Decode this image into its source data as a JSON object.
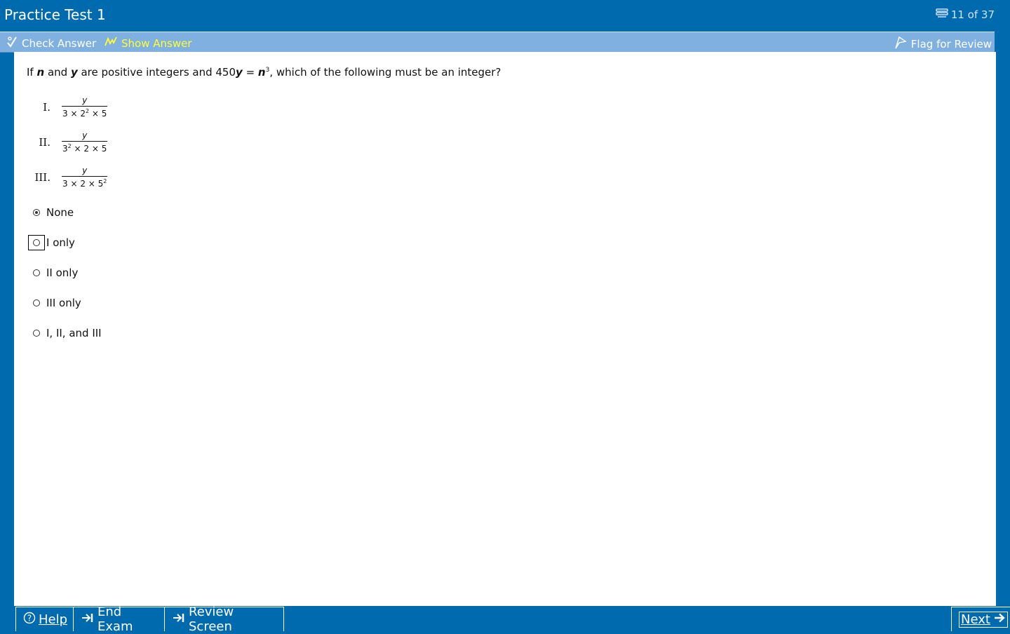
{
  "window": {
    "title": "Practice Test 1",
    "counter": "11 of 37"
  },
  "toolbar": {
    "check_answer": "Check Answer",
    "show_answer": "Show Answer",
    "flag_for_review": "Flag for Review"
  },
  "question": {
    "text_if": "If ",
    "var_n": "n",
    "text_and": " and ",
    "var_y": "y",
    "text_mid": " are positive integers and 450",
    "var_y2": "y",
    "text_eq": " = ",
    "var_n2": "n",
    "exp": "3",
    "text_end": ", which of the following must be an integer?"
  },
  "statements": [
    {
      "roman": "I.",
      "numerator": "y",
      "den_a": "3 × 2",
      "den_a_sup": "2",
      "den_b": " × 5",
      "den_b_sup": ""
    },
    {
      "roman": "II.",
      "numerator": "y",
      "den_a": "3",
      "den_a_sup": "2",
      "den_b": " × 2 × 5",
      "den_b_sup": ""
    },
    {
      "roman": "III.",
      "numerator": "y",
      "den_a": "3 × 2 × 5",
      "den_a_sup": "2",
      "den_b": "",
      "den_b_sup": ""
    }
  ],
  "choices": [
    {
      "label": "None",
      "selected": true
    },
    {
      "label": "I only",
      "selected": false,
      "focused": true
    },
    {
      "label": "II only",
      "selected": false
    },
    {
      "label": "III only",
      "selected": false
    },
    {
      "label": "I, II, and III",
      "selected": false
    }
  ],
  "footer": {
    "help": "Help",
    "end_exam": "End Exam",
    "review_screen": "Review Screen",
    "next": "Next"
  },
  "colors": {
    "frame": "#006aae",
    "toolbar": "#7fb0e0",
    "show_answer": "#ffff33"
  }
}
